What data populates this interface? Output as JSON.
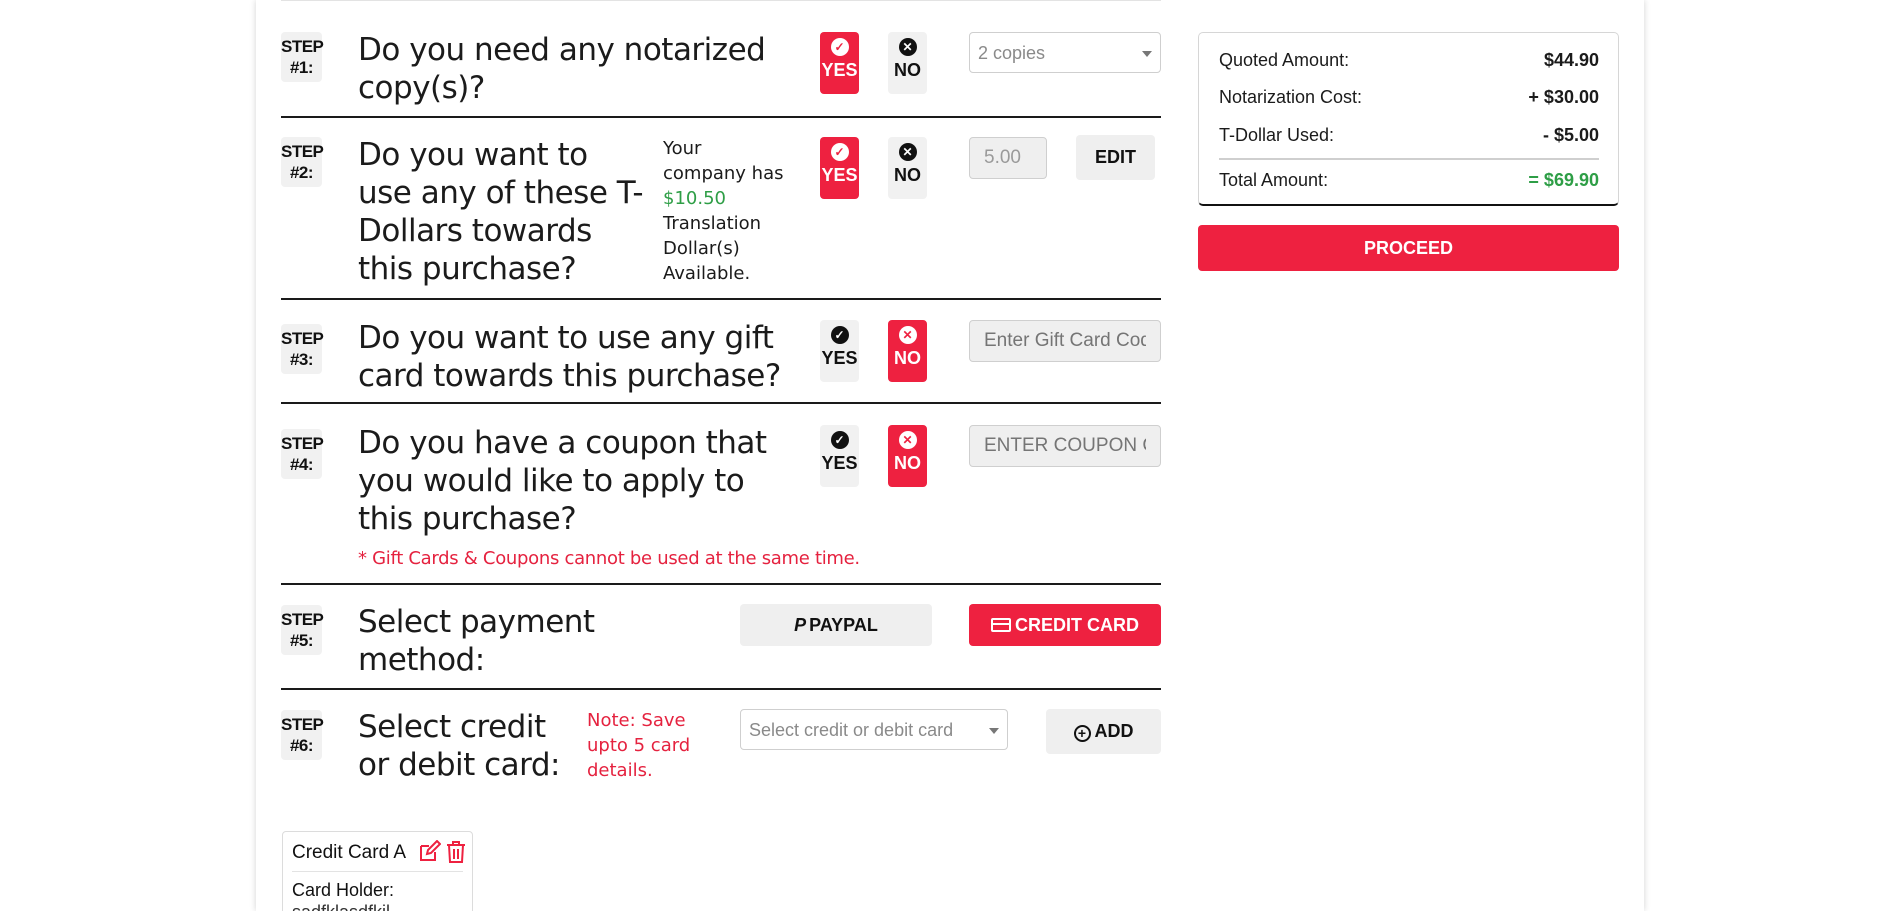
{
  "steps": {
    "s1": {
      "badge_line1": "STEP",
      "badge_line2": "#1:",
      "question": "Do you need any notarized copy(s)?",
      "yes": "YES",
      "no": "NO",
      "select_value": "2 copies"
    },
    "s2": {
      "badge_line1": "STEP",
      "badge_line2": "#2:",
      "question": "Do you want to use any of these T-Dollars towards this purchase?",
      "info_prefix": "Your company has",
      "info_amount": "$10.50",
      "info_suffix": "Translation Dollar(s) Available.",
      "yes": "YES",
      "no": "NO",
      "input_value": "5.00",
      "edit_label": "EDIT"
    },
    "s3": {
      "badge_line1": "STEP",
      "badge_line2": "#3:",
      "question": "Do you want to use any gift card towards this purchase?",
      "yes": "YES",
      "no": "NO",
      "input_placeholder": "Enter Gift Card Code"
    },
    "s4": {
      "badge_line1": "STEP",
      "badge_line2": "#4:",
      "question": "Do you have a coupon that you would like to apply to this purchase?",
      "warning": "* Gift Cards & Coupons cannot be used at the same time.",
      "yes": "YES",
      "no": "NO",
      "input_placeholder": "ENTER COUPON CODE"
    },
    "s5": {
      "badge_line1": "STEP",
      "badge_line2": "#5:",
      "question": "Select payment method:",
      "paypal_label": "PAYPAL",
      "credit_label": "CREDIT CARD"
    },
    "s6": {
      "badge_line1": "STEP",
      "badge_line2": "#6:",
      "question": "Select credit or debit card:",
      "note": "Note: Save upto 5 card details.",
      "select_placeholder": "Select credit or debit card",
      "add_label": "ADD"
    }
  },
  "summary": {
    "quoted_label": "Quoted Amount:",
    "quoted_value": "$44.90",
    "notary_label": "Notarization Cost:",
    "notary_value": "+ $30.00",
    "tdollar_label": "T-Dollar Used:",
    "tdollar_value": "- $5.00",
    "total_label": "Total Amount:",
    "total_value": "= $69.90",
    "proceed_label": "PROCEED"
  },
  "card": {
    "title": "Credit Card A",
    "holder_label": "Card Holder:",
    "holder_value": "sadfklasdfkjl"
  },
  "colors": {
    "accent": "#ee2140",
    "green": "#2e9e46"
  }
}
